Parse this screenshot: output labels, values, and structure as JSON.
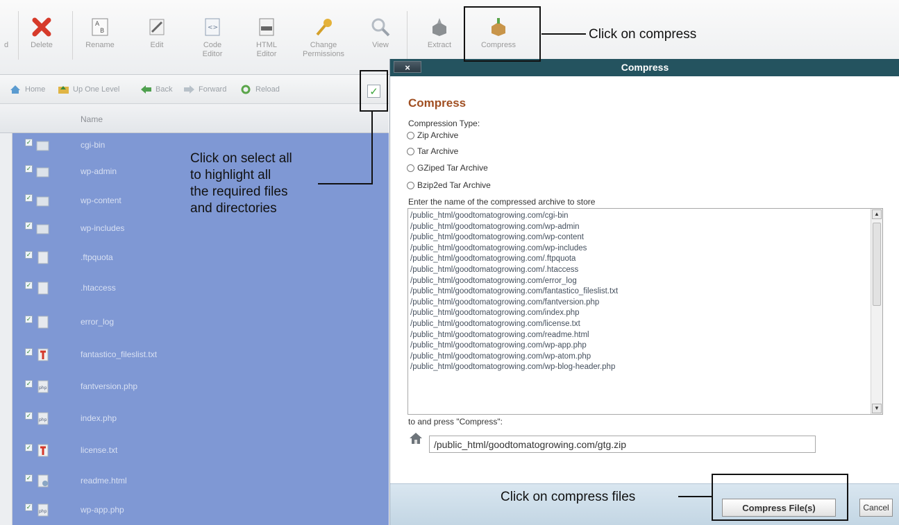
{
  "toolbar": {
    "items": [
      {
        "label": "d",
        "icon": "upload-icon"
      },
      {
        "label": "Delete",
        "icon": "delete-icon"
      },
      {
        "label": "Rename",
        "icon": "rename-icon"
      },
      {
        "label": "Edit",
        "icon": "edit-icon"
      },
      {
        "label": "Code Editor",
        "icon": "code-editor-icon"
      },
      {
        "label": "HTML Editor",
        "icon": "html-editor-icon"
      },
      {
        "label": "Change Permissions",
        "icon": "key-icon"
      },
      {
        "label": "View",
        "icon": "magnifier-icon"
      },
      {
        "label": "Extract",
        "icon": "extract-icon"
      },
      {
        "label": "Compress",
        "icon": "compress-icon"
      }
    ]
  },
  "nav": {
    "home": "Home",
    "up_one_level": "Up One Level",
    "back": "Back",
    "forward": "Forward",
    "reload": "Reload"
  },
  "filelist": {
    "column_name": "Name",
    "files": [
      {
        "name": "cgi-bin",
        "type": "folder"
      },
      {
        "name": "wp-admin",
        "type": "folder"
      },
      {
        "name": "wp-content",
        "type": "folder"
      },
      {
        "name": "wp-includes",
        "type": "folder"
      },
      {
        "name": ".ftpquota",
        "type": "file"
      },
      {
        "name": ".htaccess",
        "type": "file"
      },
      {
        "name": "error_log",
        "type": "file"
      },
      {
        "name": "fantastico_fileslist.txt",
        "type": "text"
      },
      {
        "name": "fantversion.php",
        "type": "php"
      },
      {
        "name": "index.php",
        "type": "php"
      },
      {
        "name": "license.txt",
        "type": "text"
      },
      {
        "name": "readme.html",
        "type": "html"
      },
      {
        "name": "wp-app.php",
        "type": "php"
      }
    ]
  },
  "dialog": {
    "title": "Compress",
    "close": "×",
    "heading": "Compress",
    "compression_type_label": "Compression Type:",
    "options": [
      "Zip Archive",
      "Tar Archive",
      "GZiped Tar Archive",
      "Bzip2ed Tar Archive"
    ],
    "enter_name_label": "Enter the name of the compressed archive to store",
    "paths": [
      "/public_html/goodtomatogrowing.com/cgi-bin",
      "/public_html/goodtomatogrowing.com/wp-admin",
      "/public_html/goodtomatogrowing.com/wp-content",
      "/public_html/goodtomatogrowing.com/wp-includes",
      "/public_html/goodtomatogrowing.com/.ftpquota",
      "/public_html/goodtomatogrowing.com/.htaccess",
      "/public_html/goodtomatogrowing.com/error_log",
      "/public_html/goodtomatogrowing.com/fantastico_fileslist.txt",
      "/public_html/goodtomatogrowing.com/fantversion.php",
      "/public_html/goodtomatogrowing.com/index.php",
      "/public_html/goodtomatogrowing.com/license.txt",
      "/public_html/goodtomatogrowing.com/readme.html",
      "/public_html/goodtomatogrowing.com/wp-app.php",
      "/public_html/goodtomatogrowing.com/wp-atom.php",
      "/public_html/goodtomatogrowing.com/wp-blog-header.php"
    ],
    "press_label": "to and press \"Compress\":",
    "destination": "/public_html/goodtomatogrowing.com/gtg.zip",
    "compress_button": "Compress File(s)",
    "cancel_button": "Cancel"
  },
  "annotations": {
    "click_compress": "Click on compress",
    "select_all": [
      "Click on select all",
      "to highlight all",
      "the required files",
      "and directories"
    ],
    "compress_files": "Click on compress files"
  },
  "colors": {
    "file_list_bg": "#7f98d4",
    "dialog_titlebar": "#24535f",
    "heading": "#a04f22"
  }
}
